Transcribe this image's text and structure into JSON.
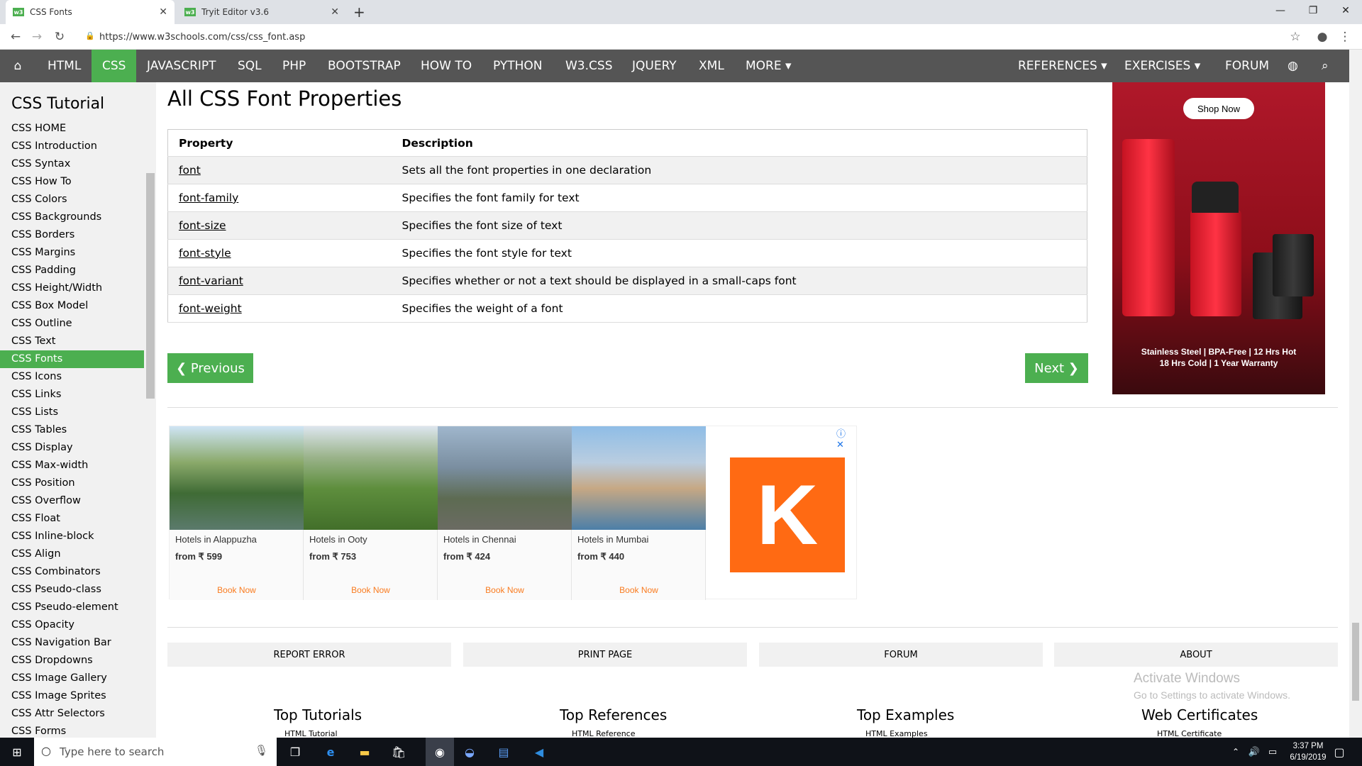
{
  "browser": {
    "tabs": [
      {
        "title": "CSS Fonts"
      },
      {
        "title": "Tryit Editor v3.6"
      }
    ],
    "url": "https://www.w3schools.com/css/css_font.asp"
  },
  "topnav": {
    "items": [
      "HTML",
      "CSS",
      "JAVASCRIPT",
      "SQL",
      "PHP",
      "BOOTSTRAP",
      "HOW TO",
      "PYTHON",
      "W3.CSS",
      "JQUERY",
      "XML",
      "MORE ▾"
    ],
    "right_items": [
      "REFERENCES ▾",
      "EXERCISES ▾",
      "FORUM"
    ],
    "active": "CSS"
  },
  "sidebar": {
    "title": "CSS Tutorial",
    "items": [
      "CSS HOME",
      "CSS Introduction",
      "CSS Syntax",
      "CSS How To",
      "CSS Colors",
      "CSS Backgrounds",
      "CSS Borders",
      "CSS Margins",
      "CSS Padding",
      "CSS Height/Width",
      "CSS Box Model",
      "CSS Outline",
      "CSS Text",
      "CSS Fonts",
      "CSS Icons",
      "CSS Links",
      "CSS Lists",
      "CSS Tables",
      "CSS Display",
      "CSS Max-width",
      "CSS Position",
      "CSS Overflow",
      "CSS Float",
      "CSS Inline-block",
      "CSS Align",
      "CSS Combinators",
      "CSS Pseudo-class",
      "CSS Pseudo-element",
      "CSS Opacity",
      "CSS Navigation Bar",
      "CSS Dropdowns",
      "CSS Image Gallery",
      "CSS Image Sprites",
      "CSS Attr Selectors",
      "CSS Forms"
    ],
    "active": "CSS Fonts"
  },
  "main": {
    "heading": "All CSS Font Properties",
    "table": {
      "headers": [
        "Property",
        "Description"
      ],
      "rows": [
        [
          "font",
          "Sets all the font properties in one declaration"
        ],
        [
          "font-family",
          "Specifies the font family for text"
        ],
        [
          "font-size",
          "Specifies the font size of text"
        ],
        [
          "font-style",
          "Specifies the font style for text"
        ],
        [
          "font-variant",
          "Specifies whether or not a text should be displayed in a small-caps font"
        ],
        [
          "font-weight",
          "Specifies the weight of a font"
        ]
      ]
    },
    "prev_label": "❮ Previous",
    "next_label": "Next ❯"
  },
  "hotel_ad": {
    "hotels": [
      {
        "name": "Hotels in Alappuzha",
        "price": "from ₹ 599",
        "cta": "Book Now"
      },
      {
        "name": "Hotels in Ooty",
        "price": "from ₹ 753",
        "cta": "Book Now"
      },
      {
        "name": "Hotels in Chennai",
        "price": "from ₹ 424",
        "cta": "Book Now"
      },
      {
        "name": "Hotels in Mumbai",
        "price": "from ₹ 440",
        "cta": "Book Now"
      }
    ],
    "logo_letter": "K"
  },
  "footer": {
    "buttons": [
      "REPORT ERROR",
      "PRINT PAGE",
      "FORUM",
      "ABOUT"
    ],
    "sections": [
      {
        "title": "Top Tutorials",
        "first": "HTML Tutorial"
      },
      {
        "title": "Top References",
        "first": "HTML Reference"
      },
      {
        "title": "Top Examples",
        "first": "HTML Examples"
      },
      {
        "title": "Web Certificates",
        "first": "HTML Certificate"
      }
    ]
  },
  "side_ad": {
    "cta": "Shop Now",
    "line1": "Stainless Steel | BPA-Free | 12 Hrs Hot",
    "line2": "18 Hrs Cold | 1 Year Warranty"
  },
  "watermark": {
    "title": "Activate Windows",
    "subtitle": "Go to Settings to activate Windows."
  },
  "taskbar": {
    "search_placeholder": "Type here to search",
    "time": "3:37 PM",
    "date": "6/19/2019"
  }
}
